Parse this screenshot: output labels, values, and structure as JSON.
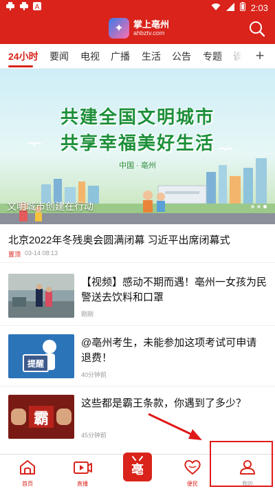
{
  "status": {
    "time": "2:03",
    "notification_icons": [
      "app-notification-icon",
      "app-notification-icon",
      "letter-a-icon"
    ]
  },
  "app": {
    "logo_title": "掌上亳州",
    "logo_subtitle": "ahbztv.com"
  },
  "tabs": [
    "24小时",
    "要闻",
    "电视",
    "广播",
    "生活",
    "公告",
    "专题",
    "诶"
  ],
  "active_tab": "24小时",
  "banner": {
    "line1": "共建全国文明城市",
    "line2": "共享幸福美好生活",
    "sub": "中国 · 亳州",
    "caption": "文明城市创建在行动"
  },
  "headline": {
    "title": "北京2022年冬残奥会圆满闭幕 习近平出席闭幕式",
    "tag": "置顶",
    "time": "03-14 08:13"
  },
  "news": [
    {
      "title": "【视频】感动不期而遇！亳州一女孩为民警送去饮料和口罩",
      "time": "刚刚",
      "thumb": "video-thumbnail"
    },
    {
      "title": "@亳州考生，未能参加这项考试可申请退费！",
      "time": "40分钟前",
      "thumb": "reminder-thumbnail"
    },
    {
      "title": "这些都是霸王条款，你遇到了多少？",
      "time": "45分钟前",
      "thumb": "overlord-clause-thumbnail"
    }
  ],
  "nav": {
    "home": "首页",
    "live": "直播",
    "center": "center-logo",
    "service": "便民",
    "mine": "我的"
  },
  "colors": {
    "brand_red": "#d9231b",
    "annotation_red": "#e01818"
  }
}
